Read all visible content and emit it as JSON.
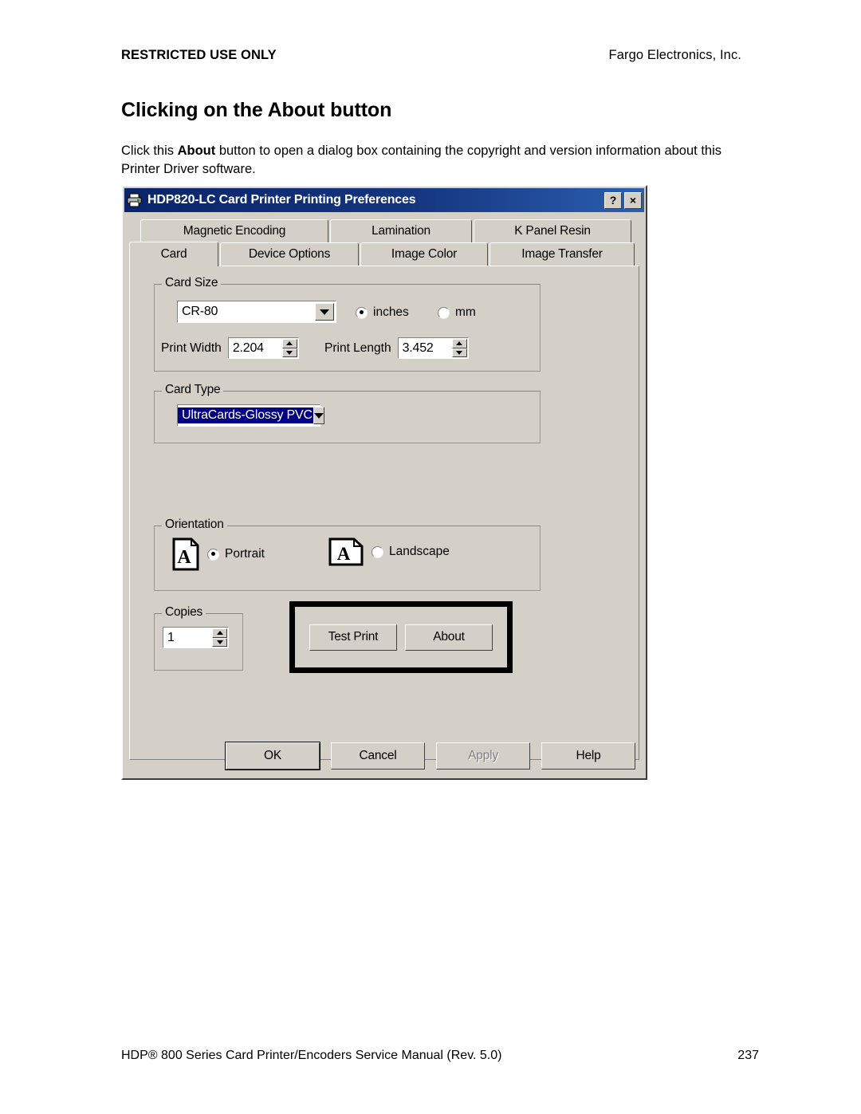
{
  "page": {
    "header_left": "RESTRICTED USE ONLY",
    "header_right": "Fargo Electronics, Inc.",
    "title": "Clicking on the About button",
    "paragraph_prefix": "Click this ",
    "paragraph_bold": "About",
    "paragraph_suffix": " button to open a dialog box containing the copyright and version information about this Printer Driver software.",
    "footer_left": "HDP® 800 Series Card Printer/Encoders Service Manual (Rev. 5.0)",
    "footer_right": "237"
  },
  "dialog": {
    "title": "HDP820-LC Card Printer Printing Preferences",
    "titlebar_icon": "printer-icon",
    "help_button": "?",
    "close_button": "×",
    "tabs_row1": [
      {
        "label": "Magnetic Encoding",
        "active": false
      },
      {
        "label": "Lamination",
        "active": false
      },
      {
        "label": "K Panel Resin",
        "active": false
      }
    ],
    "tabs_row2": [
      {
        "label": "Card",
        "active": true
      },
      {
        "label": "Device Options",
        "active": false
      },
      {
        "label": "Image Color",
        "active": false
      },
      {
        "label": "Image Transfer",
        "active": false
      }
    ],
    "card_size": {
      "group_label": "Card Size",
      "selected": "CR-80",
      "units": [
        {
          "label": "inches",
          "selected": true
        },
        {
          "label": "mm",
          "selected": false
        }
      ],
      "print_width_label": "Print Width",
      "print_width_value": "2.204",
      "print_length_label": "Print Length",
      "print_length_value": "3.452"
    },
    "card_type": {
      "group_label": "Card Type",
      "selected": "UltraCards-Glossy PVC"
    },
    "orientation": {
      "group_label": "Orientation",
      "options": [
        {
          "label": "Portrait",
          "selected": true,
          "glyph": "A"
        },
        {
          "label": "Landscape",
          "selected": false,
          "glyph": "A"
        }
      ]
    },
    "copies": {
      "group_label": "Copies",
      "value": "1"
    },
    "action_buttons": {
      "test_print": "Test Print",
      "about": "About"
    },
    "bottom_buttons": [
      {
        "label": "OK",
        "enabled": true,
        "default": true
      },
      {
        "label": "Cancel",
        "enabled": true,
        "default": false
      },
      {
        "label": "Apply",
        "enabled": false,
        "default": false
      },
      {
        "label": "Help",
        "enabled": true,
        "default": false
      }
    ]
  },
  "colors": {
    "dialog_face": "#d4d0c8",
    "titlebar_start": "#0a246a",
    "titlebar_end": "#2a5fb0",
    "selection_blue": "#000080",
    "highlight_box": "#000000",
    "disabled_text": "#808080"
  }
}
